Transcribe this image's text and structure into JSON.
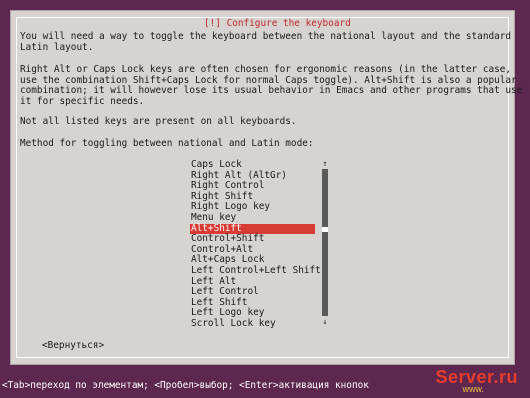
{
  "dialog": {
    "title": "[!] Configure the keyboard",
    "paragraphs": [
      "You will need a way to toggle the keyboard between the national layout and the standard\nLatin layout.",
      "Right Alt or Caps Lock keys are often chosen for ergonomic reasons (in the latter case,\nuse the combination Shift+Caps Lock for normal Caps toggle). Alt+Shift is also a popular\ncombination; it will however lose its usual behavior in Emacs and other programs that use\nit for specific needs.",
      "Not all listed keys are present on all keyboards.",
      "Method for toggling between national and Latin mode:"
    ],
    "options": [
      "Caps Lock",
      "Right Alt (AltGr)",
      "Right Control",
      "Right Shift",
      "Right Logo key",
      "Menu key",
      "Alt+Shift",
      "Control+Shift",
      "Control+Alt",
      "Alt+Caps Lock",
      "Left Control+Left Shift",
      "Left Alt",
      "Left Control",
      "Left Shift",
      "Left Logo key",
      "Scroll Lock key"
    ],
    "selected_index": 6,
    "back_button": "<Вернуться>"
  },
  "status_bar": "<Tab>переход по элементам; <Пробел>выбор; <Enter>активация кнопок",
  "watermark": {
    "text": "Server.ru",
    "sub": "www."
  },
  "colors": {
    "background": "#5e2750",
    "dialog": "#d6d3d0",
    "selection": "#d73b33",
    "title": "#c0282d"
  }
}
